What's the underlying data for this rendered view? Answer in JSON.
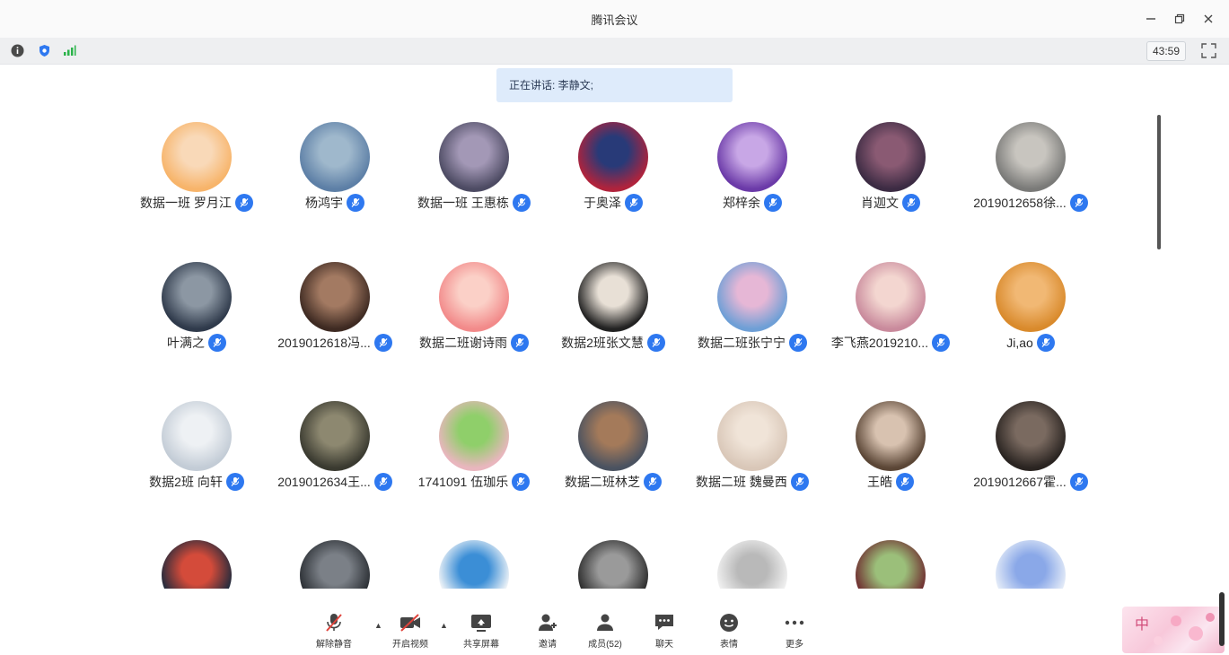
{
  "window": {
    "title": "腾讯会议"
  },
  "status": {
    "timer": "43:59"
  },
  "speaking": {
    "text": "正在讲话: 李静文;"
  },
  "participants": [
    {
      "name": "数据一班  罗月江"
    },
    {
      "name": "杨鸿宇"
    },
    {
      "name": "数据一班 王惠栋"
    },
    {
      "name": "于奥泽"
    },
    {
      "name": "郑梓余"
    },
    {
      "name": "肖迦文"
    },
    {
      "name": "2019012658徐..."
    },
    {
      "name": "叶满之"
    },
    {
      "name": "2019012618冯..."
    },
    {
      "name": "数据二班谢诗雨"
    },
    {
      "name": "数据2班张文慧"
    },
    {
      "name": "数据二班张宁宁"
    },
    {
      "name": "李飞燕2019210..."
    },
    {
      "name": "Ji,ao"
    },
    {
      "name": "数据2班 向轩"
    },
    {
      "name": "2019012634王..."
    },
    {
      "name": "1741091 伍珈乐"
    },
    {
      "name": "数据二班林芝"
    },
    {
      "name": "数据二班 魏曼西"
    },
    {
      "name": "王皓"
    },
    {
      "name": "2019012667霍..."
    },
    {
      "name": ""
    },
    {
      "name": ""
    },
    {
      "name": ""
    },
    {
      "name": ""
    },
    {
      "name": ""
    },
    {
      "name": ""
    },
    {
      "name": ""
    }
  ],
  "toolbar": {
    "unmute": "解除静音",
    "video": "开启视频",
    "share": "共享屏幕",
    "invite": "邀请",
    "members": "成员(52)",
    "chat": "聊天",
    "reaction": "表情",
    "more": "更多"
  },
  "sticker": {
    "text": "中"
  },
  "colors": {
    "accent": "#2e78f0",
    "banner": "#deebfb",
    "muted_red": "#e0433b"
  }
}
